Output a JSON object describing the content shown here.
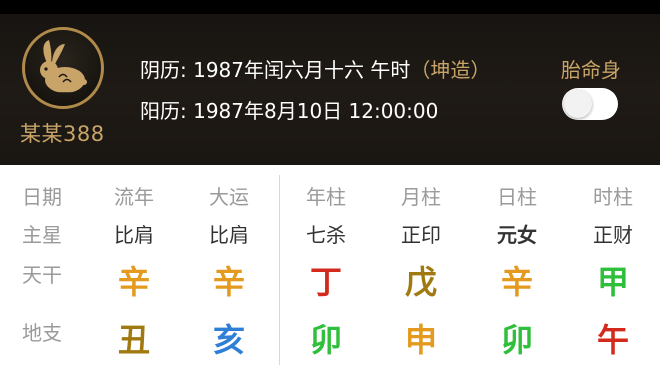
{
  "header": {
    "username": "某某388",
    "lunar_date": "阴历: 1987年闰六月十六 午时",
    "gender_tag": "（坤造）",
    "solar_date": "阳历: 1987年8月10日 12:00:00",
    "toggle_label": "胎命身",
    "toggle_on": false
  },
  "table": {
    "row_labels": [
      "日期",
      "主星",
      "天干",
      "地支"
    ],
    "columns": [
      {
        "header": "流年",
        "star": "比肩",
        "stem": "辛",
        "branch": "丑"
      },
      {
        "header": "大运",
        "star": "比肩",
        "stem": "辛",
        "branch": "亥"
      },
      {
        "header": "年柱",
        "star": "七杀",
        "stem": "丁",
        "branch": "卯"
      },
      {
        "header": "月柱",
        "star": "正印",
        "stem": "戊",
        "branch": "申"
      },
      {
        "header": "日柱",
        "star": "元女",
        "stem": "辛",
        "branch": "卯"
      },
      {
        "header": "时柱",
        "star": "正财",
        "stem": "甲",
        "branch": "午"
      }
    ]
  },
  "colors": {
    "gold": "#e39a1e",
    "earth": "#a07a10",
    "water": "#2f7fd6",
    "fire": "#d42a1e",
    "wood": "#2fbf3a"
  }
}
